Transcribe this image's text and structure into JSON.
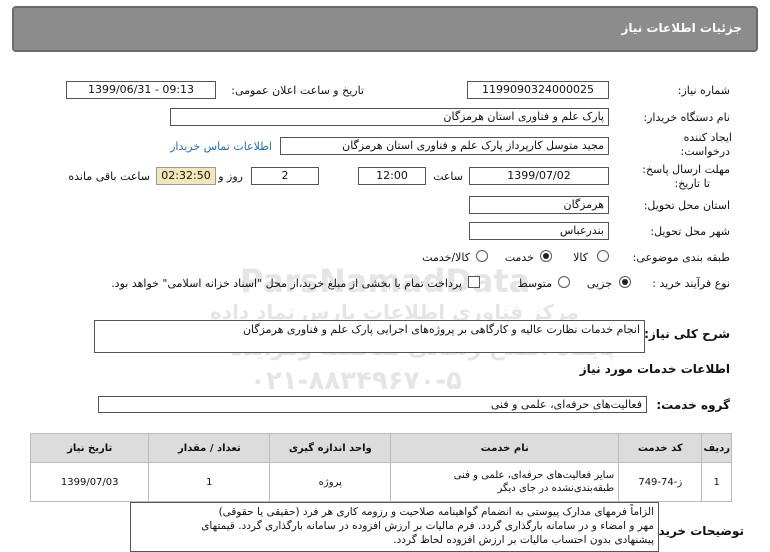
{
  "header": {
    "title": "جزئیات اطلاعات نیاز"
  },
  "need_number": {
    "label": "شماره نیاز:",
    "value": "1199090324000025"
  },
  "announce": {
    "label": "تاریخ و ساعت اعلان عمومی:",
    "value": "1399/06/31 - 09:13"
  },
  "buyer": {
    "label": "نام دستگاه خریدار:",
    "value": "پارک علم و فناوری استان هرمزگان"
  },
  "creator": {
    "label_line1": "ایجاد کننده",
    "label_line2": "درخواست:",
    "value": "مجید متوسل کارپرداز پارک علم و فناوری استان هرمزگان",
    "contact_link": "اطلاعات تماس خریدار"
  },
  "deadline": {
    "label_line1": "مهلت ارسال پاسخ:",
    "label_line2": "تا تاریخ:",
    "date": "1399/07/02",
    "time_label": "ساعت",
    "time": "12:00",
    "days": "2",
    "days_label": "روز و",
    "remaining": "02:32:50",
    "remaining_label": "ساعت باقی مانده"
  },
  "province": {
    "label": "استان محل تحویل:",
    "value": "هرمزگان"
  },
  "city": {
    "label": "شهر محل تحویل:",
    "value": "بندرعباس"
  },
  "category": {
    "label": "طبقه بندی موضوعی:",
    "options": [
      "کالا",
      "خدمت",
      "کالا/خدمت"
    ],
    "selected": "خدمت"
  },
  "process": {
    "label": "نوع فرآیند خرید :",
    "options": [
      "جزیی",
      "متوسط"
    ],
    "selected": "جزیی",
    "payment_note": "پرداخت تمام یا بخشی از مبلغ خرید،از محل \"اسناد خزانه اسلامی\" خواهد بود."
  },
  "description": {
    "label": "شرح کلی نیاز:",
    "value": "انجام خدمات نظارت عالیه و کارگاهی بر پروژه‌های اجرایی پارک علم و فناوری هرمزگان"
  },
  "services_heading": "اطلاعات خدمات مورد نیاز",
  "service_group": {
    "label": "گروه خدمت:",
    "value": "فعالیت‌های حرفه‌ای، علمی و فنی"
  },
  "table": {
    "headers": [
      "ردیف",
      "کد خدمت",
      "نام خدمت",
      "واحد اندازه گیری",
      "تعداد / مقدار",
      "تاریخ نیاز"
    ],
    "rows": [
      [
        "1",
        "ز-74-749",
        "سایر فعالیت‌های حرفه‌ای، علمی و فنی طبقه‌بندی‌نشده در جای دیگر",
        "پروژه",
        "1",
        "1399/07/03"
      ]
    ]
  },
  "notes": {
    "label": "توضیحات خریدار:",
    "lines": [
      "الزاماً فرمهای مدارک پیوستی به انضمام گواهینامه صلاحیت و رزومه کاری هر فرد (حقیقی یا حقوقی)",
      "مهر و امضاء و در سامانه بارگذاری گردد. فرم مالیات بر ارزش افزوده در سامانه بارگذاری گردد. قیمتهای",
      "پیشنهادی بدون احتساب مالیات بر ارزش افزوده لحاظ گردد."
    ]
  },
  "watermark": {
    "line1": "ParsNamadData",
    "line2": "مرکز فناوری اطلاعات پارس نماد داده",
    "line3": "پایگاه اطلاع رسانی مناقصه ومزایده",
    "line4": "۰۲۱-۸۸۳۴۹۶۷۰-۵"
  }
}
